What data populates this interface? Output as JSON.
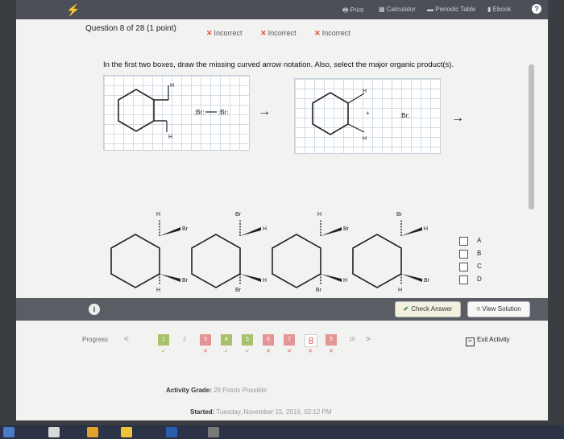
{
  "topbar": {
    "print": "Print",
    "calculator": "Calculator",
    "periodic_table": "Periodic Table",
    "ebook": "Ebook",
    "help": "?"
  },
  "question": {
    "header": "Question 8 of 28 (1 point)",
    "attempts": [
      "Incorrect",
      "Incorrect",
      "Incorrect"
    ],
    "prompt": "In the first two boxes, draw the missing curved arrow notation. Also, select the major organic product(s)."
  },
  "structures": {
    "h": "H",
    "br": "Br",
    "bromide": ":Br:"
  },
  "options": [
    "A",
    "B",
    "C",
    "D"
  ],
  "actions": {
    "info": "i",
    "check_answer": "Check Answer",
    "view_solution": "View Solution"
  },
  "progress": {
    "label": "Progress",
    "prev": "<",
    "next": ">",
    "items": [
      {
        "n": "1",
        "color": "#a7c26a",
        "mark": "✓",
        "mark_color": "#7fa23a"
      },
      {
        "n": "2",
        "color": "#f2f2f0",
        "mark": "",
        "mark_color": "#999"
      },
      {
        "n": "3",
        "color": "#e39494",
        "mark": "✕",
        "mark_color": "#d06565"
      },
      {
        "n": "4",
        "color": "#a7c26a",
        "mark": "✓",
        "mark_color": "#7fa23a"
      },
      {
        "n": "5",
        "color": "#a7c26a",
        "mark": "✓",
        "mark_color": "#7fa23a"
      },
      {
        "n": "6",
        "color": "#e39494",
        "mark": "✕",
        "mark_color": "#d06565"
      },
      {
        "n": "7",
        "color": "#e39494",
        "mark": "✕",
        "mark_color": "#d06565"
      },
      {
        "n": "8",
        "color": "#ffffff",
        "mark": "✕",
        "mark_color": "#d06565"
      },
      {
        "n": "9",
        "color": "#e39494",
        "mark": "✕",
        "mark_color": "#d06565"
      },
      {
        "n": "10",
        "color": "#f2f2f0",
        "mark": "",
        "mark_color": "#999"
      }
    ],
    "exit": "Exit Activity"
  },
  "footer": {
    "grade_label": "Activity Grade:",
    "grade_value": "28 Points Possible",
    "started_label": "Started:",
    "started_value": "Tuesday, November 15, 2016, 02:12 PM"
  },
  "colors": {
    "incorrect": "#e24a3a",
    "correct": "#2b8a2b",
    "topbar": "#4c4f57",
    "actionbar": "#5a5d64"
  }
}
